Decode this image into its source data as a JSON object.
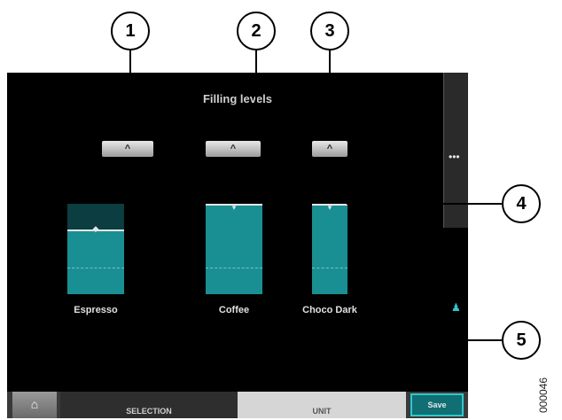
{
  "callouts": [
    "1",
    "2",
    "3",
    "4",
    "5"
  ],
  "screen": {
    "title": "Filling levels"
  },
  "up_buttons": [
    "^",
    "^",
    "^"
  ],
  "gauges": [
    {
      "label": "Espresso",
      "level_percent": 72,
      "marker": "◆"
    },
    {
      "label": "Coffee",
      "level_percent": 100,
      "marker": "▾"
    },
    {
      "label": "Choco Dark",
      "level_percent": 100,
      "marker": "▾"
    }
  ],
  "side_icons": [
    "coffee-beans-icon",
    "cup-drop-icon"
  ],
  "side_glyphs": {
    "beans": "•••",
    "cup": "♟"
  },
  "bottom_bar": {
    "home_icon": "⌂",
    "tab_selection": "SELECTION",
    "tab_unit": "UNIT",
    "save": "Save"
  },
  "figure_code": "000046"
}
